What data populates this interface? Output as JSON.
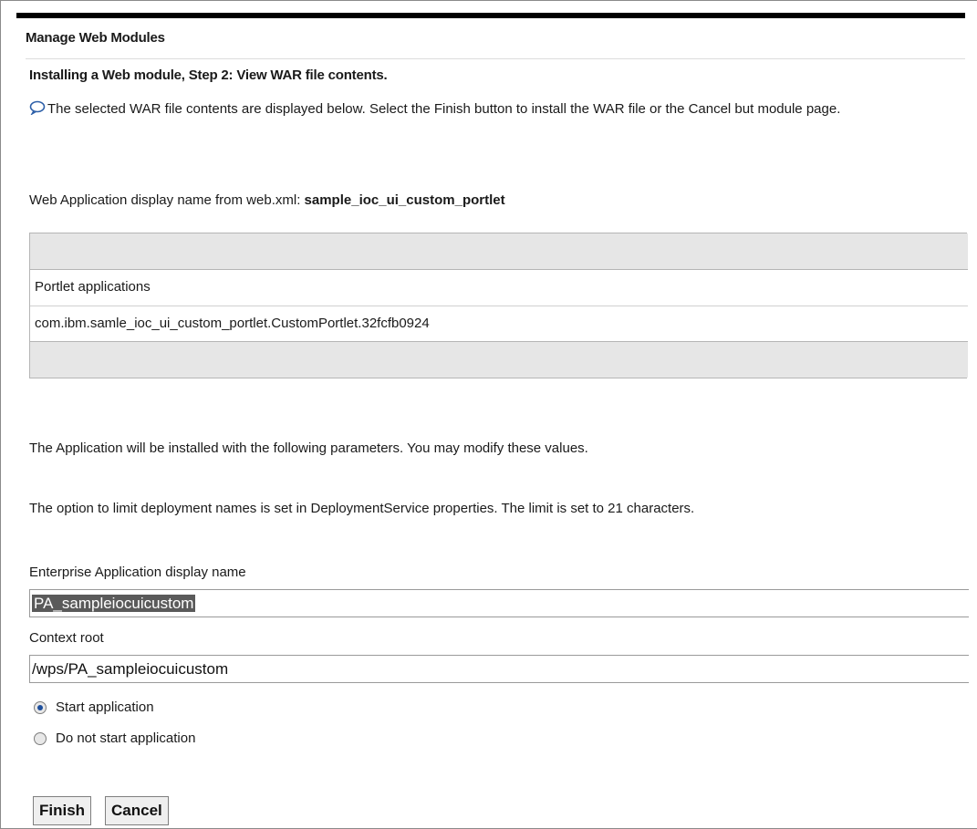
{
  "header": {
    "title": "Manage Web Modules"
  },
  "step": {
    "heading": "Installing a Web module, Step 2: View WAR file contents.",
    "description": "The selected WAR file contents are displayed below. Select the Finish button to install the WAR file or the Cancel but module page.",
    "help_icon": "help-bubble-icon"
  },
  "web_app": {
    "label": "Web Application display name from web.xml: ",
    "value": "sample_ioc_ui_custom_portlet"
  },
  "portlet_table": {
    "header": "",
    "column": "Portlet applications",
    "rows": [
      "com.ibm.samle_ioc_ui_custom_portlet.CustomPortlet.32fcfb0924"
    ],
    "footer": ""
  },
  "params": {
    "line1": "The Application will be installed with the following parameters. You may modify these values.",
    "line2": "The option to limit deployment names is set in DeploymentService properties. The limit is set to 21 characters."
  },
  "form": {
    "enterprise_label": "Enterprise Application display name",
    "enterprise_value": "PA_sampleiocuicustom",
    "context_label": "Context root",
    "context_value": "/wps/PA_sampleiocuicustom",
    "start_option": "Start application",
    "no_start_option": "Do not start application",
    "selected": "Start application"
  },
  "buttons": {
    "finish": "Finish",
    "cancel": "Cancel"
  },
  "colors": {
    "header_bar": "#000000",
    "table_band": "#e6e6e6",
    "radio_selected": "#1e4f9c"
  }
}
